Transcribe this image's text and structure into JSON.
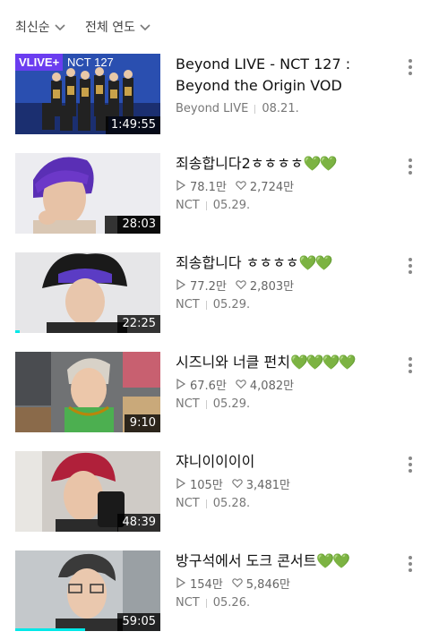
{
  "filters": {
    "sort_label": "최신순",
    "year_label": "전체 연도"
  },
  "videos": [
    {
      "title": "Beyond LIVE - NCT 127 : Beyond the Origin VOD",
      "channel": "Beyond LIVE",
      "date": "08.21.",
      "duration": "1:49:55",
      "badge": "VLIVE+",
      "thumb_caption": "NCT 127"
    },
    {
      "title": "죄송합니다2ㅎㅎㅎㅎ",
      "hearts": "💚💚",
      "plays": "78.1만",
      "likes": "2,724만",
      "channel": "NCT",
      "date": "05.29.",
      "duration": "28:03"
    },
    {
      "title": "죄송합니다 ㅎㅎㅎㅎ",
      "hearts": "💚💚",
      "plays": "77.2만",
      "likes": "2,803만",
      "channel": "NCT",
      "date": "05.29.",
      "duration": "22:25",
      "progress": 0.03
    },
    {
      "title": "시즈니와 너클 펀치",
      "hearts": "💚💚💚💚",
      "plays": "67.6만",
      "likes": "4,082만",
      "channel": "NCT",
      "date": "05.29.",
      "duration": "9:10"
    },
    {
      "title": "쟈니이이이이",
      "hearts": "",
      "plays": "105만",
      "likes": "3,481만",
      "channel": "NCT",
      "date": "05.28.",
      "duration": "48:39"
    },
    {
      "title": "방구석에서 도크 콘서트",
      "hearts": "💚💚",
      "plays": "154만",
      "likes": "5,846만",
      "channel": "NCT",
      "date": "05.26.",
      "duration": "59:05",
      "progress": 0.48
    }
  ],
  "colors": {
    "accent_progress": "#00e8e8",
    "heart_green": "#33cc14",
    "vlive_purple": "#6b3df0"
  }
}
